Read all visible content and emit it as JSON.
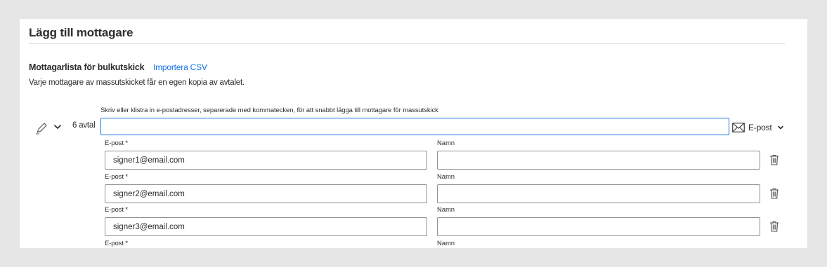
{
  "dialog": {
    "title": "Lägg till mottagare"
  },
  "bulk": {
    "section_title": "Mottagarlista för bulkutskick",
    "import_link": "Importera CSV",
    "description": "Varje mottagare av massutskicket får en egen kopia av avtalet.",
    "hint": "Skriv eller klistra in e-postadresser, separerade med kommatecken, för att snabbt lägga till mottagare för massutskick",
    "agreement_count": "6 avtal",
    "input_value": "",
    "delivery_method": "E-post"
  },
  "recipients": [
    {
      "email_label": "E-post *",
      "name_label": "Namn",
      "email": "signer1@email.com",
      "name": ""
    },
    {
      "email_label": "E-post *",
      "name_label": "Namn",
      "email": "signer2@email.com",
      "name": ""
    },
    {
      "email_label": "E-post *",
      "name_label": "Namn",
      "email": "signer3@email.com",
      "name": ""
    },
    {
      "email_label": "E-post *",
      "name_label": "Namn",
      "email": "",
      "name": ""
    }
  ],
  "icons": {
    "pen": "pen-icon",
    "expand": "chevron-down-icon",
    "delivery": "envelope-icon",
    "delete": "trash-icon"
  },
  "colors": {
    "accent": "#1473e6",
    "page_background": "#e6e6e6",
    "panel_background": "#ffffff"
  }
}
